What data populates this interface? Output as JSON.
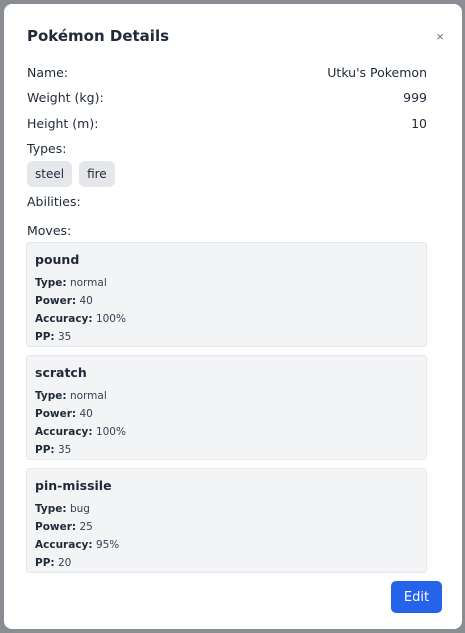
{
  "modal": {
    "title": "Pokémon Details",
    "close_icon": "×",
    "edit_label": "Edit"
  },
  "details": {
    "name_label": "Name:",
    "name_value": "Utku's Pokemon",
    "weight_label": "Weight (kg):",
    "weight_value": "999",
    "height_label": "Height (m):",
    "height_value": "10",
    "types_label": "Types:",
    "types": [
      "steel",
      "fire"
    ],
    "abilities_label": "Abilities:",
    "moves_label": "Moves:"
  },
  "move_field_labels": {
    "type": "Type:",
    "power": "Power:",
    "accuracy": "Accuracy:",
    "pp": "PP:"
  },
  "moves": [
    {
      "name": "pound",
      "type": "normal",
      "power": "40",
      "accuracy": "100%",
      "pp": "35"
    },
    {
      "name": "scratch",
      "type": "normal",
      "power": "40",
      "accuracy": "100%",
      "pp": "35"
    },
    {
      "name": "pin-missile",
      "type": "bug",
      "power": "25",
      "accuracy": "95%",
      "pp": "20"
    }
  ],
  "colors": {
    "primary": "#2563eb",
    "card_background": "#f3f4f6",
    "badge_background": "#e5e7eb"
  }
}
